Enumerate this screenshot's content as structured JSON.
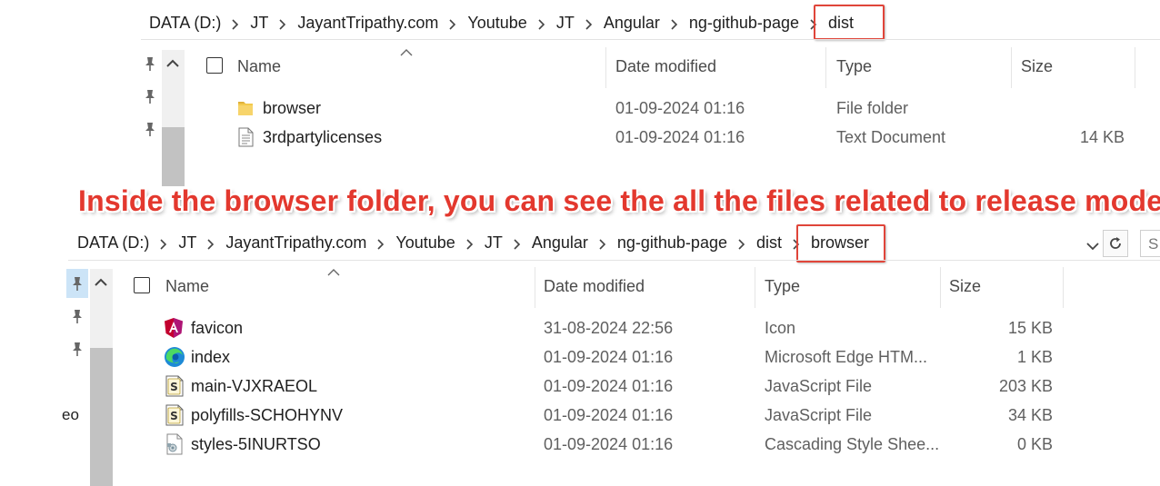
{
  "top": {
    "breadcrumbs": [
      "DATA (D:)",
      "JT",
      "JayantTripathy.com",
      "Youtube",
      "JT",
      "Angular",
      "ng-github-page",
      "dist"
    ],
    "columns": {
      "name": "Name",
      "date": "Date modified",
      "type": "Type",
      "size": "Size"
    },
    "rows": [
      {
        "name": "browser",
        "date": "01-09-2024 01:16",
        "type": "File folder",
        "size": "",
        "icon": "folder-icon"
      },
      {
        "name": "3rdpartylicenses",
        "date": "01-09-2024 01:16",
        "type": "Text Document",
        "size": "14 KB",
        "icon": "text-document-icon"
      }
    ]
  },
  "annotation": "Inside the browser folder, you can see the all the files related to release mode",
  "bottom": {
    "breadcrumbs": [
      "DATA (D:)",
      "JT",
      "JayantTripathy.com",
      "Youtube",
      "JT",
      "Angular",
      "ng-github-page",
      "dist",
      "browser"
    ],
    "search_partial": "S",
    "left_partial": "eo",
    "columns": {
      "name": "Name",
      "date": "Date modified",
      "type": "Type",
      "size": "Size"
    },
    "rows": [
      {
        "name": "favicon",
        "date": "31-08-2024 22:56",
        "type": "Icon",
        "size": "15 KB",
        "icon": "angular-icon"
      },
      {
        "name": "index",
        "date": "01-09-2024 01:16",
        "type": "Microsoft Edge HTM...",
        "size": "1 KB",
        "icon": "edge-icon"
      },
      {
        "name": "main-VJXRAEOL",
        "date": "01-09-2024 01:16",
        "type": "JavaScript File",
        "size": "203 KB",
        "icon": "javascript-file-icon"
      },
      {
        "name": "polyfills-SCHOHYNV",
        "date": "01-09-2024 01:16",
        "type": "JavaScript File",
        "size": "34 KB",
        "icon": "javascript-file-icon"
      },
      {
        "name": "styles-5INURTSO",
        "date": "01-09-2024 01:16",
        "type": "Cascading Style Shee...",
        "size": "0 KB",
        "icon": "css-file-icon"
      }
    ]
  },
  "colors": {
    "highlight": "#e0453a",
    "annotation": "#e3382e"
  }
}
